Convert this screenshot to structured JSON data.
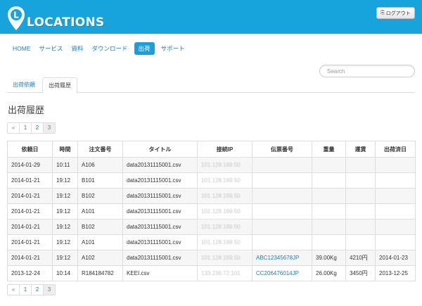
{
  "header": {
    "brand": "LOCATIONS",
    "logout_label": "ログアウト",
    "logout_icon": "sign-out-icon"
  },
  "nav": {
    "items": [
      {
        "label": "HOME",
        "active": false
      },
      {
        "label": "サービス",
        "active": false
      },
      {
        "label": "資料",
        "active": false
      },
      {
        "label": "ダウンロード",
        "active": false
      },
      {
        "label": "出荷",
        "active": true
      },
      {
        "label": "サポート",
        "active": false
      }
    ]
  },
  "search": {
    "placeholder": "Search",
    "value": ""
  },
  "tabs": [
    {
      "label": "出荷依頼",
      "active": false
    },
    {
      "label": "出荷履歴",
      "active": true
    }
  ],
  "page_title": "出荷履歴",
  "pagination": {
    "prev": "«",
    "pages": [
      "1",
      "2",
      "3"
    ],
    "current": "3"
  },
  "table": {
    "columns": [
      "依頼日",
      "時間",
      "注文番号",
      "タイトル",
      "接続IP",
      "伝票番号",
      "重量",
      "運賃",
      "出荷済日"
    ],
    "rows": [
      [
        "2014-01-29",
        "10:11",
        "A106",
        "data20131115001.csv",
        "101.128.169.50",
        "",
        "",
        "",
        ""
      ],
      [
        "2014-01-21",
        "19:12",
        "B101",
        "data20131115001.csv",
        "101.128.169.50",
        "",
        "",
        "",
        ""
      ],
      [
        "2014-01-21",
        "19:12",
        "B102",
        "data20131115001.csv",
        "101.128.169.50",
        "",
        "",
        "",
        ""
      ],
      [
        "2014-01-21",
        "19:12",
        "A101",
        "data20131115001.csv",
        "101.128.169.50",
        "",
        "",
        "",
        ""
      ],
      [
        "2014-01-21",
        "19:12",
        "B102",
        "data20131115001.csv",
        "101.128.169.50",
        "",
        "",
        "",
        ""
      ],
      [
        "2014-01-21",
        "19:12",
        "A101",
        "data20131115001.csv",
        "101.128.169.50",
        "",
        "",
        "",
        ""
      ],
      [
        "2014-01-21",
        "19:12",
        "A102",
        "data20131115001.csv",
        "101.128.169.50",
        "ABC12345678JP",
        "39.00Kg",
        "4210円",
        "2014-01-23"
      ],
      [
        "2013-12-24",
        "10:14",
        "R184184782",
        "KEEI.csv",
        "133.236.72.101",
        "CC206476014JP",
        "26.00Kg",
        "3450円",
        "2013-12-25"
      ]
    ]
  },
  "colors": {
    "header_bg": "#17a3db",
    "accent": "#1a7fc4",
    "active_nav": "#1a9fdc"
  }
}
